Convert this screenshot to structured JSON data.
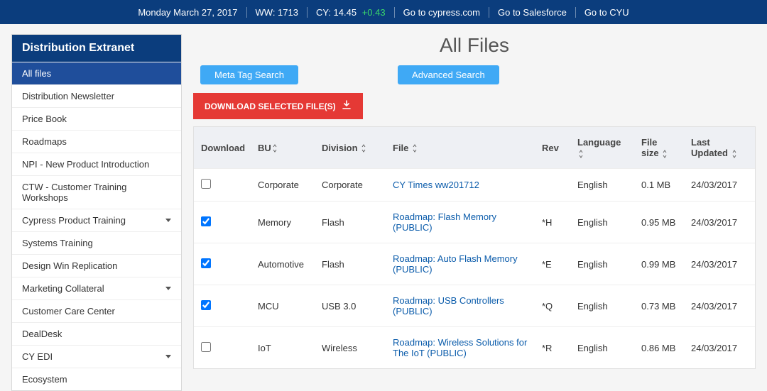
{
  "topbar": {
    "date": "Monday March 27, 2017",
    "ww": "WW: 1713",
    "stock_label": "CY: 14.45",
    "stock_delta": "+0.43",
    "links": [
      "Go to cypress.com",
      "Go to Salesforce",
      "Go to CYU"
    ]
  },
  "sidebar": {
    "title": "Distribution Extranet",
    "items": [
      {
        "label": "All files",
        "active": true,
        "expandable": false
      },
      {
        "label": "Distribution Newsletter",
        "active": false,
        "expandable": false
      },
      {
        "label": "Price Book",
        "active": false,
        "expandable": false
      },
      {
        "label": "Roadmaps",
        "active": false,
        "expandable": false
      },
      {
        "label": "NPI - New Product Introduction",
        "active": false,
        "expandable": false
      },
      {
        "label": "CTW - Customer Training Workshops",
        "active": false,
        "expandable": false
      },
      {
        "label": "Cypress Product Training",
        "active": false,
        "expandable": true
      },
      {
        "label": "Systems Training",
        "active": false,
        "expandable": false
      },
      {
        "label": "Design Win Replication",
        "active": false,
        "expandable": false
      },
      {
        "label": "Marketing Collateral",
        "active": false,
        "expandable": true
      },
      {
        "label": "Customer Care Center",
        "active": false,
        "expandable": false
      },
      {
        "label": "DealDesk",
        "active": false,
        "expandable": false
      },
      {
        "label": "CY EDI",
        "active": false,
        "expandable": true
      },
      {
        "label": "Ecosystem",
        "active": false,
        "expandable": false
      }
    ]
  },
  "main": {
    "title": "All Files",
    "meta_tag_search": "Meta Tag Search",
    "advanced_search": "Advanced Search",
    "download_selected": "DOWNLOAD SELECTED FILE(S)",
    "columns": {
      "download": "Download",
      "bu": "BU",
      "division": "Division",
      "file": "File",
      "rev": "Rev",
      "language": "Language",
      "file_size": "File size",
      "last_updated": "Last Updated"
    },
    "rows": [
      {
        "checked": false,
        "bu": "Corporate",
        "division": "Corporate",
        "file": "CY Times ww201712",
        "rev": "",
        "language": "English",
        "size": "0.1 MB",
        "updated": "24/03/2017"
      },
      {
        "checked": true,
        "bu": "Memory",
        "division": "Flash",
        "file": "Roadmap: Flash Memory (PUBLIC)",
        "rev": "*H",
        "language": "English",
        "size": "0.95 MB",
        "updated": "24/03/2017"
      },
      {
        "checked": true,
        "bu": "Automotive",
        "division": "Flash",
        "file": "Roadmap: Auto Flash Memory (PUBLIC)",
        "rev": "*E",
        "language": "English",
        "size": "0.99 MB",
        "updated": "24/03/2017"
      },
      {
        "checked": true,
        "bu": "MCU",
        "division": "USB 3.0",
        "file": "Roadmap: USB Controllers (PUBLIC)",
        "rev": "*Q",
        "language": "English",
        "size": "0.73 MB",
        "updated": "24/03/2017"
      },
      {
        "checked": false,
        "bu": "IoT",
        "division": "Wireless",
        "file": "Roadmap: Wireless Solutions for The IoT (PUBLIC)",
        "rev": "*R",
        "language": "English",
        "size": "0.86 MB",
        "updated": "24/03/2017"
      }
    ]
  }
}
